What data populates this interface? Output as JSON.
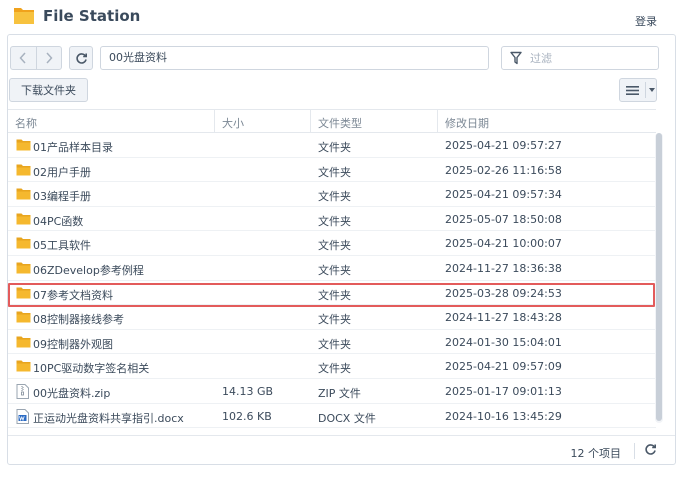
{
  "app": {
    "title": "File Station",
    "login": "登录",
    "icon": "folder-app-icon"
  },
  "toolbar": {
    "path": "00光盘资料",
    "filter_placeholder": "过滤",
    "download_label": "下载文件夹"
  },
  "columns": {
    "name": "名称",
    "size": "大小",
    "type": "文件类型",
    "modified": "修改日期"
  },
  "files": [
    {
      "name": "01产品样本目录",
      "size": "",
      "type": "文件夹",
      "modified": "2025-04-21 09:57:27",
      "icon": "folder-icon"
    },
    {
      "name": "02用户手册",
      "size": "",
      "type": "文件夹",
      "modified": "2025-02-26 11:16:58",
      "icon": "folder-icon"
    },
    {
      "name": "03编程手册",
      "size": "",
      "type": "文件夹",
      "modified": "2025-04-21 09:57:34",
      "icon": "folder-icon"
    },
    {
      "name": "04PC函数",
      "size": "",
      "type": "文件夹",
      "modified": "2025-05-07 18:50:08",
      "icon": "folder-icon",
      "highlighted": true
    },
    {
      "name": "05工具软件",
      "size": "",
      "type": "文件夹",
      "modified": "2025-04-21 10:00:07",
      "icon": "folder-icon"
    },
    {
      "name": "06ZDevelop参考例程",
      "size": "",
      "type": "文件夹",
      "modified": "2024-11-27 18:36:38",
      "icon": "folder-icon"
    },
    {
      "name": "07参考文档资料",
      "size": "",
      "type": "文件夹",
      "modified": "2025-03-28 09:24:53",
      "icon": "folder-icon"
    },
    {
      "name": "08控制器接线参考",
      "size": "",
      "type": "文件夹",
      "modified": "2024-11-27 18:43:28",
      "icon": "folder-icon"
    },
    {
      "name": "09控制器外观图",
      "size": "",
      "type": "文件夹",
      "modified": "2024-01-30 15:04:01",
      "icon": "folder-icon"
    },
    {
      "name": "10PC驱动数字签名相关",
      "size": "",
      "type": "文件夹",
      "modified": "2025-04-21 09:57:09",
      "icon": "folder-icon"
    },
    {
      "name": "00光盘资料.zip",
      "size": "14.13 GB",
      "type": "ZIP 文件",
      "modified": "2025-01-17 09:01:13",
      "icon": "zip-file-icon"
    },
    {
      "name": "正运动光盘资料共享指引.docx",
      "size": "102.6 KB",
      "type": "DOCX 文件",
      "modified": "2024-10-16 13:45:29",
      "icon": "word-doc-icon"
    }
  ],
  "footer": {
    "count": "12 个项目"
  },
  "colors": {
    "highlight": "#e35b5b",
    "folder": "#f5b82e",
    "accent": "#3a4a5c"
  }
}
